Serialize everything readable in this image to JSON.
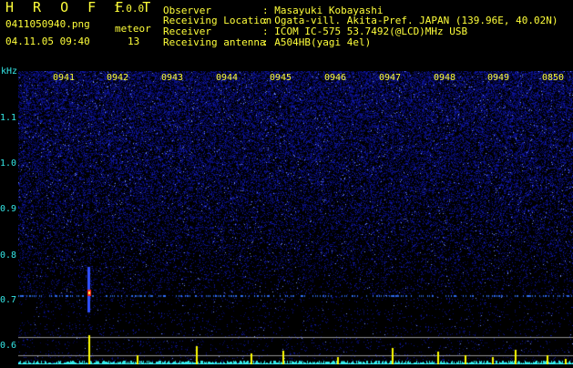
{
  "header": {
    "app_title": "H R O F F T",
    "version": "1.0.0",
    "filename": "0411050940.png",
    "meteor_label": "meteor",
    "datetime": "04.11.05 09:40",
    "meteor_count": "13",
    "info": [
      {
        "label": "Observer",
        "value": ": Masayuki Kobayashi"
      },
      {
        "label": "Receiving Location",
        "value": ": Ogata-vill. Akita-Pref. JAPAN (139.96E, 40.02N)"
      },
      {
        "label": "Receiver",
        "value": ": ICOM IC-575 53.7492(@LCD)MHz USB"
      },
      {
        "label": "Receiving antenna",
        "value": ": A504HB(yagi 4el)"
      }
    ]
  },
  "axes": {
    "y_unit": "kHz",
    "y_ticks": [
      "1.1",
      "1.0",
      "0.9",
      "0.8",
      "0.7",
      "0.6"
    ],
    "x_ticks": [
      "0941",
      "0942",
      "0943",
      "0944",
      "0945",
      "0946",
      "0947",
      "0948",
      "0949",
      "0850"
    ]
  },
  "colors": {
    "background": "#000000",
    "noise": "#1a1aa0",
    "signal_line": "#2a60d0",
    "meteor": "#ff2020",
    "count_bars": "#ffff00",
    "cyan": "#34e7e7",
    "yellow": "#ffff3a"
  }
}
